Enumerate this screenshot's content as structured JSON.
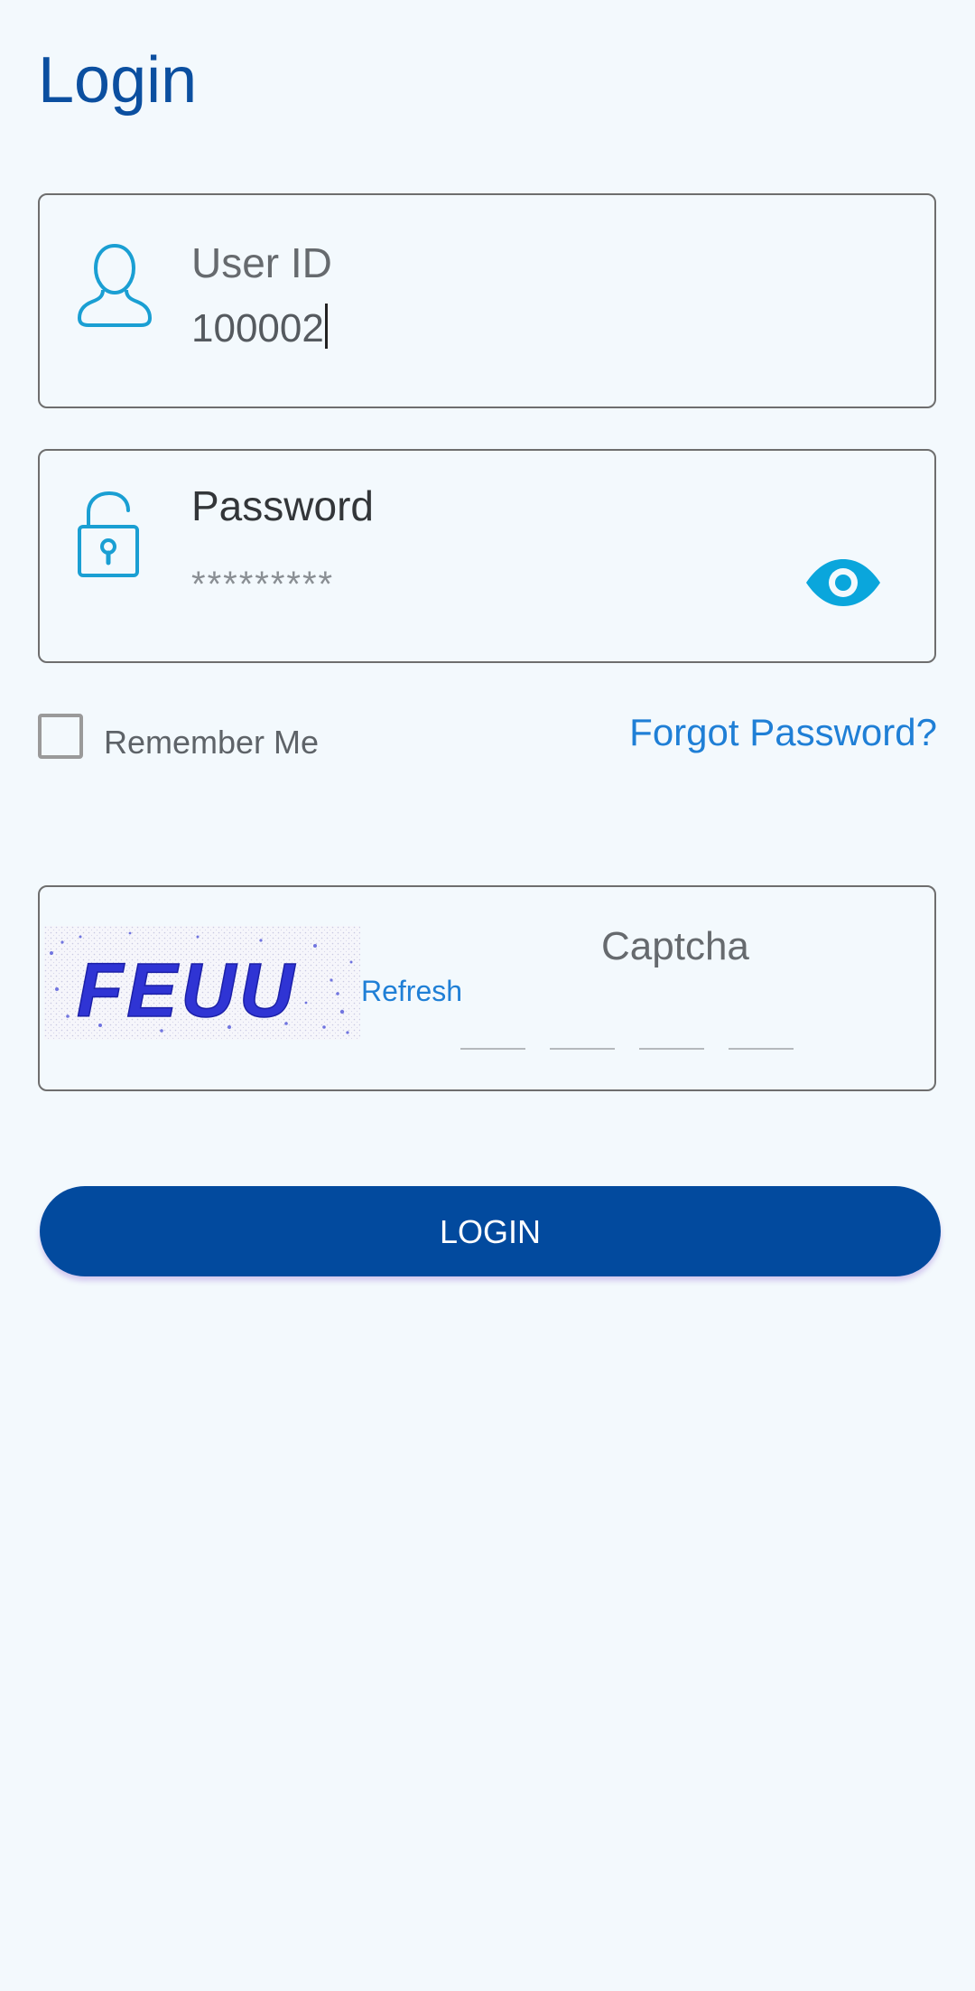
{
  "header": {
    "title": "Login"
  },
  "user_id": {
    "label": "User ID",
    "value": "100002",
    "icon": "user-icon"
  },
  "password": {
    "label": "Password",
    "value": "*********",
    "icon": "lock-icon",
    "toggle_icon": "eye-icon"
  },
  "options": {
    "remember_label": "Remember Me",
    "remember_checked": false,
    "forgot_label": "Forgot Password?"
  },
  "captcha": {
    "image_text": "FEUU",
    "refresh_label": "Refresh",
    "label": "Captcha",
    "slots": 4
  },
  "actions": {
    "login_label": "LOGIN"
  },
  "colors": {
    "background": "#f3f9fd",
    "primary": "#024a9e",
    "link": "#1f7fd6",
    "icon": "#1a9fd3"
  }
}
